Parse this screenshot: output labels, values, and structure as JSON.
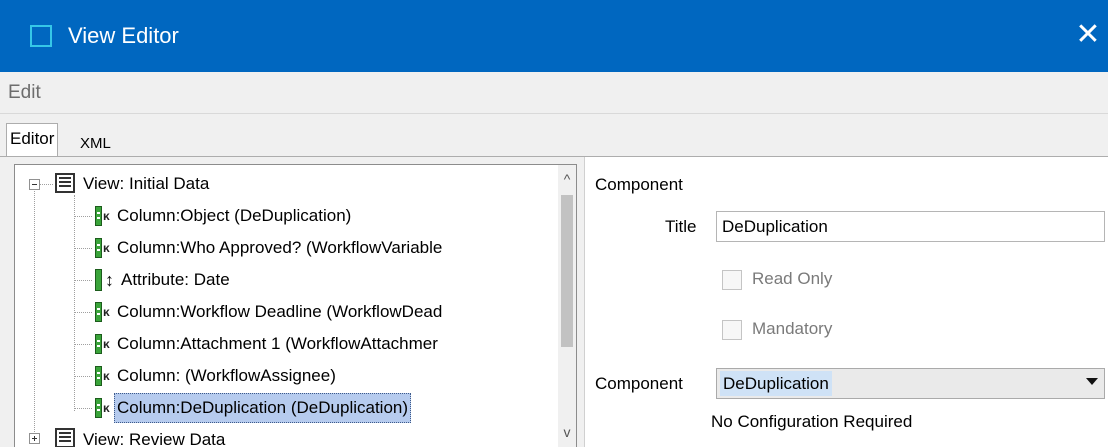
{
  "window": {
    "title": "View Editor",
    "close_glyph": "✕",
    "icon": "window-app-icon"
  },
  "menu": {
    "items": [
      "Edit"
    ]
  },
  "tabs": {
    "active": "Editor",
    "inactive": "XML"
  },
  "tree": {
    "root": "View: Initial Data",
    "children": [
      {
        "label": "Column:Object (DeDuplication)",
        "icon": "column-icon"
      },
      {
        "label": "Column:Who Approved? (WorkflowVariable",
        "icon": "column-icon"
      },
      {
        "label": "Attribute: Date",
        "icon": "attribute-icon"
      },
      {
        "label": "Column:Workflow Deadline (WorkflowDead",
        "icon": "column-icon"
      },
      {
        "label": "Column:Attachment 1 (WorkflowAttachmer",
        "icon": "column-icon"
      },
      {
        "label": "Column: (WorkflowAssignee)",
        "icon": "column-icon"
      },
      {
        "label": "Column:DeDuplication (DeDuplication)",
        "icon": "column-icon",
        "selected": true
      }
    ],
    "second_root": "View: Review Data",
    "column_icon_glyph": "ᴋ",
    "attribute_icon_glyph": "↕"
  },
  "scroll": {
    "up": "^",
    "down": "v"
  },
  "component": {
    "heading": "Component",
    "title_label": "Title",
    "title_value": "DeDuplication",
    "read_only_label": "Read Only",
    "read_only_checked": false,
    "mandatory_label": "Mandatory",
    "mandatory_checked": false,
    "component_label": "Component",
    "component_value": "DeDuplication",
    "config_note": "No Configuration Required"
  }
}
